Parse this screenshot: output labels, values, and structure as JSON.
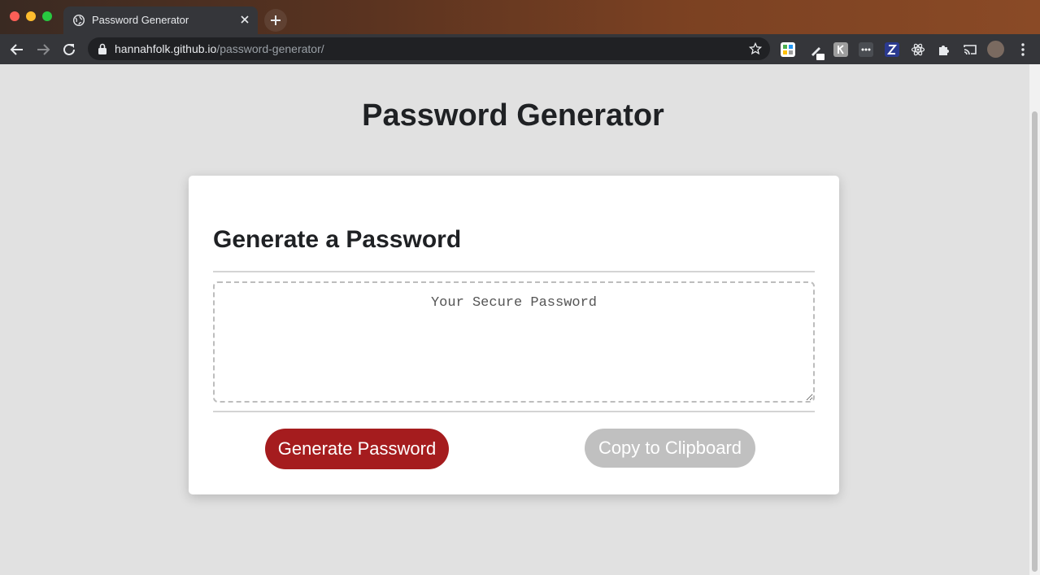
{
  "browser": {
    "tab_title": "Password Generator",
    "url_host": "hannahfolk.github.io",
    "url_path": "/password-generator/"
  },
  "page": {
    "title": "Password Generator",
    "card": {
      "header": "Generate a Password",
      "password_placeholder": "Your Secure Password",
      "generate_button": "Generate Password",
      "copy_button": "Copy to Clipboard"
    }
  },
  "colors": {
    "generate_button": "#a51c1e",
    "copy_button_disabled": "#c0c0c0",
    "page_background": "#e1e1e1"
  }
}
